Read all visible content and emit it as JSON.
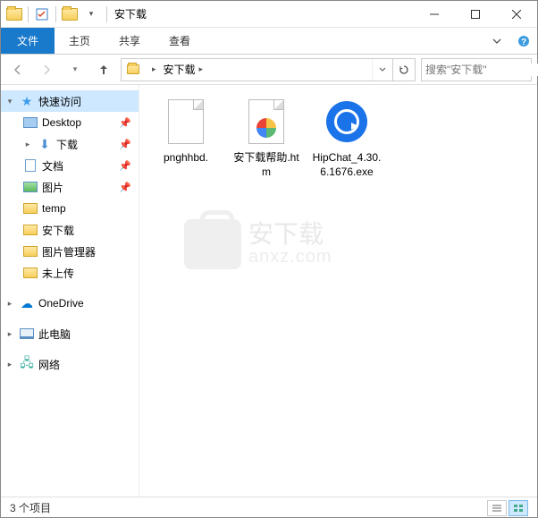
{
  "window_title": "安下载",
  "ribbon": {
    "file": "文件",
    "home": "主页",
    "share": "共享",
    "view": "查看"
  },
  "breadcrumb": {
    "segments": [
      "安下载"
    ]
  },
  "search_placeholder": "搜索\"安下载\"",
  "nav_pane": {
    "quick_access": "快速访问",
    "items": [
      {
        "label": "Desktop",
        "pinned": true
      },
      {
        "label": "下载",
        "pinned": true
      },
      {
        "label": "文档",
        "pinned": true
      },
      {
        "label": "图片",
        "pinned": true
      },
      {
        "label": "temp",
        "pinned": false
      },
      {
        "label": "安下载",
        "pinned": false
      },
      {
        "label": "图片管理器",
        "pinned": false
      },
      {
        "label": "未上传",
        "pinned": false
      }
    ],
    "onedrive": "OneDrive",
    "this_pc": "此电脑",
    "network": "网络"
  },
  "files": [
    {
      "name": "pnghhbd.",
      "type": "file"
    },
    {
      "name": "安下载帮助.htm",
      "type": "htm"
    },
    {
      "name": "HipChat_4.30.6.1676.exe",
      "type": "exe"
    }
  ],
  "watermark": {
    "main": "安下载",
    "sub": "anxz.com"
  },
  "status": "3 个项目"
}
